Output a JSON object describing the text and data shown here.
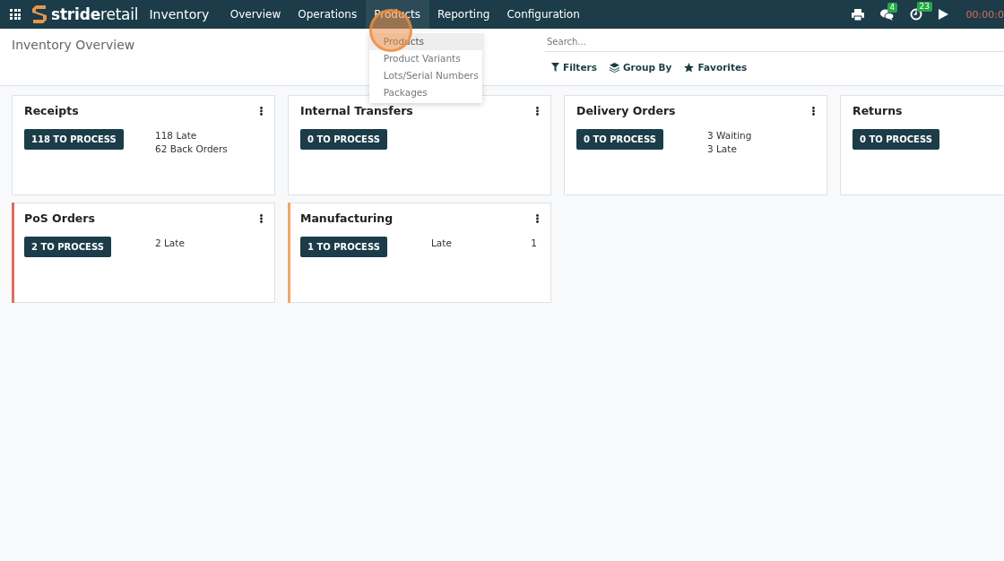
{
  "navbar": {
    "brand": "**stride**retail",
    "app": "Inventory",
    "menu": [
      {
        "label": "Overview",
        "selected": false
      },
      {
        "label": "Operations",
        "selected": false
      },
      {
        "label": "Products",
        "selected": true
      },
      {
        "label": "Reporting",
        "selected": false
      },
      {
        "label": "Configuration",
        "selected": false
      }
    ],
    "systray": [
      {
        "kind": "print"
      },
      {
        "kind": "chat",
        "badge": "4"
      },
      {
        "kind": "clock",
        "badge": "23"
      },
      {
        "kind": "play"
      }
    ],
    "timer": "00:00:0"
  },
  "dropdown": {
    "items": [
      {
        "label": "Products",
        "selected": true
      },
      {
        "label": "Product Variants",
        "selected": false
      },
      {
        "label": "Lots/Serial Numbers",
        "selected": false
      },
      {
        "label": "Packages",
        "selected": false
      }
    ]
  },
  "control_panel": {
    "title": "Inventory Overview",
    "search": {
      "placeholder": "Search..."
    },
    "filters": [
      {
        "kind": "filter",
        "label": "Filters"
      },
      {
        "kind": "layers",
        "label": "Group By"
      },
      {
        "kind": "star",
        "label": "Favorites"
      }
    ]
  },
  "cards": [
    {
      "title": "Receipts",
      "button": "118 TO PROCESS",
      "stats": [
        {
          "kind": "line",
          "label": "118 Late"
        },
        {
          "kind": "line",
          "label": "62 Back Orders"
        }
      ]
    },
    {
      "title": "Internal Transfers",
      "button": "0 TO PROCESS"
    },
    {
      "title": "Delivery Orders",
      "button": "0 TO PROCESS",
      "stats": [
        {
          "kind": "line",
          "label": "3 Waiting"
        },
        {
          "kind": "line",
          "label": "3 Late"
        }
      ]
    },
    {
      "title": "Returns",
      "button": "0 TO PROCESS"
    },
    {
      "title": "PoS Orders",
      "button": "2 TO PROCESS",
      "color": "#e06c5b",
      "stats": [
        {
          "kind": "line",
          "label": "2 Late"
        }
      ]
    },
    {
      "title": "Manufacturing",
      "button": "1 TO PROCESS",
      "color": "#f0a868",
      "stats": [
        {
          "kind": "pair",
          "label": "Late",
          "value": "1"
        }
      ]
    }
  ]
}
